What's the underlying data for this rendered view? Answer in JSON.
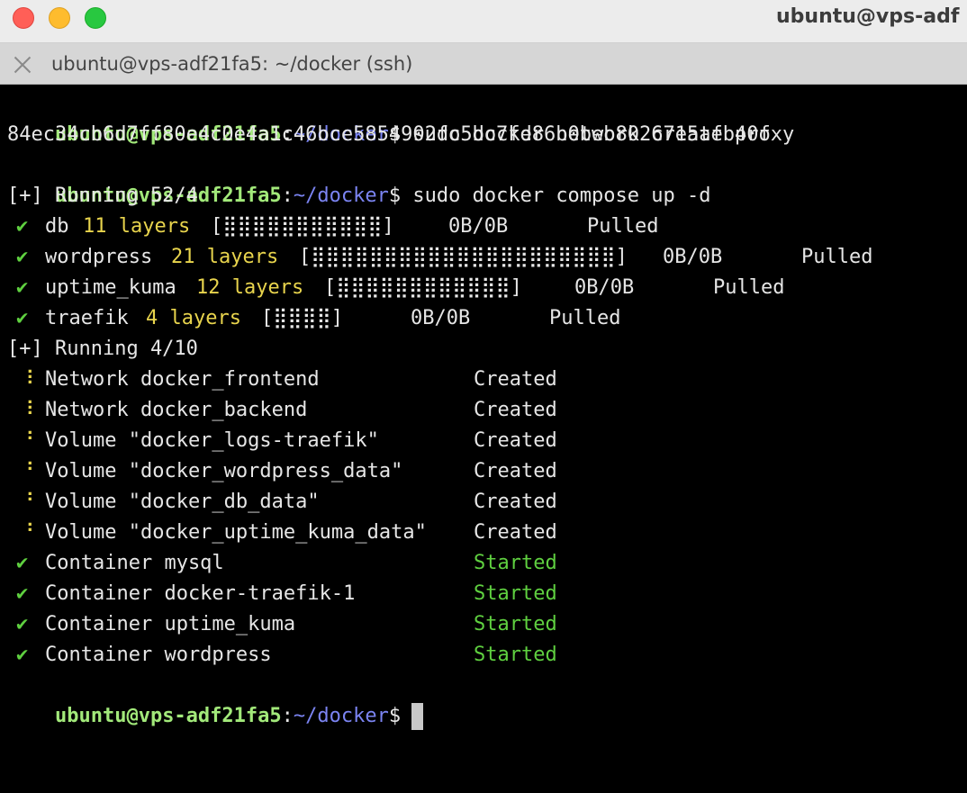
{
  "window": {
    "title": "ubuntu@vps-adf",
    "tab_label": "ubuntu@vps-adf21fa5: ~/docker (ssh)"
  },
  "prompt": {
    "user": "ubuntu@vps-adf21fa5",
    "path": "~/docker",
    "symbol": "$"
  },
  "commands": {
    "network": "sudo docker network create proxy",
    "network_output": "84ec34cb6d7ff80e4c0e4a1c46bce5854902fc5bc7fd86b0beb8026715afb40f",
    "compose": "sudo docker compose up -d"
  },
  "pull": {
    "header": "[+] Running 52/4",
    "items": [
      {
        "icon": "✔",
        "name": "db",
        "layers": "11 layers",
        "bar": "[⣿⣿⣿⣿⣿⣿⣿⣿⣿⣿⣿]",
        "size": "0B/0B",
        "status": "Pulled"
      },
      {
        "icon": "✔",
        "name": "wordpress",
        "layers": "21 layers",
        "bar": "[⣿⣿⣿⣿⣿⣿⣿⣿⣿⣿⣿⣿⣿⣿⣿⣿⣿⣿⣿⣿⣿]",
        "size": "0B/0B",
        "status": "Pulled"
      },
      {
        "icon": "✔",
        "name": "uptime_kuma",
        "layers": "12 layers",
        "bar": "[⣿⣿⣿⣿⣿⣿⣿⣿⣿⣿⣿⣿]",
        "size": "0B/0B",
        "status": "Pulled"
      },
      {
        "icon": "✔",
        "name": "traefik",
        "layers": "4 layers",
        "bar": "[⣿⣿⣿⣿]",
        "size": "0B/0B",
        "status": "Pulled"
      }
    ]
  },
  "run": {
    "header": "[+] Running 4/10",
    "items": [
      {
        "icon": "⠸",
        "label": "Network docker_frontend",
        "status": "Created"
      },
      {
        "icon": "⠸",
        "label": "Network docker_backend",
        "status": "Created"
      },
      {
        "icon": "⠘",
        "label": "Volume \"docker_logs-traefik\"",
        "status": "Created"
      },
      {
        "icon": "⠘",
        "label": "Volume \"docker_wordpress_data\"",
        "status": "Created"
      },
      {
        "icon": "⠘",
        "label": "Volume \"docker_db_data\"",
        "status": "Created"
      },
      {
        "icon": "⠘",
        "label": "Volume \"docker_uptime_kuma_data\"",
        "status": "Created"
      },
      {
        "icon": "✔",
        "label": "Container mysql",
        "status": "Started"
      },
      {
        "icon": "✔",
        "label": "Container docker-traefik-1",
        "status": "Started"
      },
      {
        "icon": "✔",
        "label": "Container uptime_kuma",
        "status": "Started"
      },
      {
        "icon": "✔",
        "label": "Container wordpress",
        "status": "Started"
      }
    ]
  }
}
